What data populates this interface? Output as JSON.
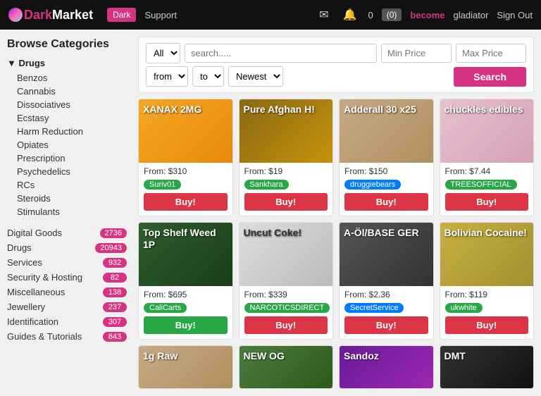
{
  "header": {
    "logo_text": "DarkMarket",
    "logo_dark": "Dark",
    "logo_market": "Market",
    "btn_dark": "Dark",
    "nav_support": "Support",
    "nav_become": "become",
    "nav_user": "gladiator",
    "nav_signout": "Sign Out",
    "cart_label": "(0)",
    "notifications": "0"
  },
  "sidebar": {
    "title": "Browse Categories",
    "drugs_section": "▼ Drugs",
    "drug_items": [
      "Benzos",
      "Cannabis",
      "Dissociatives",
      "Ecstasy",
      "Harm Reduction",
      "Opiates",
      "Prescription",
      "Psychedelics",
      "RCs",
      "Steroids",
      "Stimulants"
    ],
    "categories": [
      {
        "label": "Digital Goods",
        "count": "2736"
      },
      {
        "label": "Drugs",
        "count": "20943"
      },
      {
        "label": "Services",
        "count": "932"
      },
      {
        "label": "Security & Hosting",
        "count": "82"
      },
      {
        "label": "Miscellaneous",
        "count": "138"
      },
      {
        "label": "Jewellery",
        "count": "237"
      },
      {
        "label": "Identification",
        "count": "307"
      },
      {
        "label": "Guides & Tutorials",
        "count": "843"
      }
    ]
  },
  "search": {
    "category_default": "All",
    "placeholder": "search.....",
    "min_price_placeholder": "Min Price",
    "max_price_placeholder": "Max Price",
    "from_default": "from",
    "to_default": "to",
    "sort_default": "Newest",
    "btn_label": "Search"
  },
  "products": [
    {
      "title": "XANAX 2MG",
      "price": "From: $310",
      "seller": "Suriv01",
      "seller_color": "green",
      "buy_label": "Buy!",
      "buy_color": "red",
      "bg": "bg-orange"
    },
    {
      "title": "Pure Afghan H!",
      "price": "From: $19",
      "seller": "Sankhara",
      "seller_color": "green",
      "buy_label": "Buy!",
      "buy_color": "red",
      "bg": "bg-brown"
    },
    {
      "title": "Adderall 30 x25",
      "price": "From: $150",
      "seller": "druggiebears",
      "seller_color": "blue",
      "buy_label": "Buy!",
      "buy_color": "red",
      "bg": "bg-tan"
    },
    {
      "title": "chuckles edibles",
      "price": "From: $7.44",
      "seller": "TREESOFFICIAL",
      "seller_color": "green",
      "buy_label": "Buy!",
      "buy_color": "red",
      "bg": "bg-pink"
    },
    {
      "title": "Top Shelf Weed 1P",
      "price": "From: $695",
      "seller": "CaliCarts",
      "seller_color": "green",
      "buy_label": "Buy!",
      "buy_color": "green",
      "bg": "bg-dark-green"
    },
    {
      "title": "Uncut Coke!",
      "price": "From: $339",
      "seller": "NARCOTICSDIRECT",
      "seller_color": "green",
      "buy_label": "Buy!",
      "buy_color": "red",
      "bg": "bg-white-gray"
    },
    {
      "title": "A-Öl/BASE GER",
      "price": "From: $2.36",
      "seller": "SecretService",
      "seller_color": "blue",
      "buy_label": "Buy!",
      "buy_color": "red",
      "bg": "bg-gray"
    },
    {
      "title": "Bolivian Cocaine!",
      "price": "From: $119",
      "seller": "ukwhite",
      "seller_color": "green",
      "buy_label": "Buy!",
      "buy_color": "red",
      "bg": "bg-yellow"
    },
    {
      "title": "1g Raw",
      "price": "",
      "seller": "",
      "seller_color": "green",
      "buy_label": "",
      "buy_color": "red",
      "bg": "bg-tan"
    },
    {
      "title": "NEW OG",
      "price": "",
      "seller": "",
      "seller_color": "green",
      "buy_label": "",
      "buy_color": "red",
      "bg": "bg-green"
    },
    {
      "title": "Sandoz",
      "price": "",
      "seller": "",
      "seller_color": "green",
      "buy_label": "",
      "buy_color": "red",
      "bg": "bg-purple"
    },
    {
      "title": "DMT",
      "price": "",
      "seller": "",
      "seller_color": "green",
      "buy_label": "",
      "buy_color": "red",
      "bg": "bg-dark"
    }
  ]
}
